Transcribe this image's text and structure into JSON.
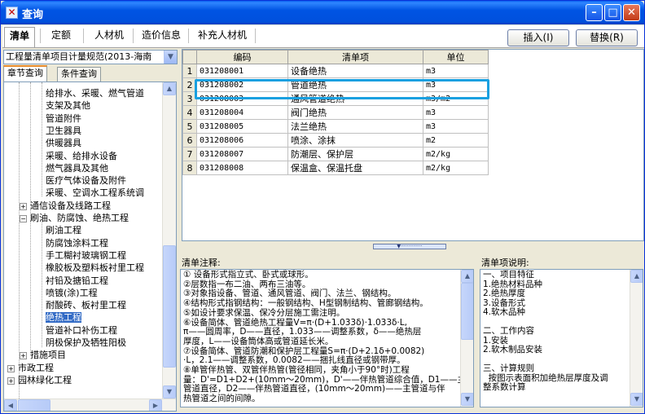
{
  "window": {
    "title": "查询",
    "icon": "app-icon",
    "buttons": [
      "minimize-icon",
      "maximize-icon",
      "close-icon"
    ]
  },
  "main_tabs": [
    "清单",
    "定额",
    "人材机",
    "造价信息",
    "补充人材机"
  ],
  "actions": {
    "insert": "插入(I)",
    "replace": "替换(R)"
  },
  "spec_select": "工程量清单项目计量规范(2013-海南",
  "left_tabs": [
    "章节查询",
    "条件查询"
  ],
  "tree": [
    {
      "label": "给排水、采暖、燃气管道",
      "level": 3
    },
    {
      "label": "支架及其他",
      "level": 3
    },
    {
      "label": "管道附件",
      "level": 3
    },
    {
      "label": "卫生器具",
      "level": 3
    },
    {
      "label": "供暖器具",
      "level": 3
    },
    {
      "label": "采暖、给排水设备",
      "level": 3
    },
    {
      "label": "燃气器具及其他",
      "level": 3
    },
    {
      "label": "医疗气体设备及附件",
      "level": 3
    },
    {
      "label": "采暖、空调水工程系统调",
      "level": 3
    },
    {
      "label": "通信设备及线路工程",
      "level": 2,
      "expander": "+"
    },
    {
      "label": "刷油、防腐蚀、绝热工程",
      "level": 2,
      "expander": "−"
    },
    {
      "label": "刷油工程",
      "level": 3
    },
    {
      "label": "防腐蚀涂料工程",
      "level": 3
    },
    {
      "label": "手工糊衬玻璃钢工程",
      "level": 3
    },
    {
      "label": "橡胶板及塑料板衬里工程",
      "level": 3
    },
    {
      "label": "衬铅及搪铅工程",
      "level": 3
    },
    {
      "label": "喷镀(涂)工程",
      "level": 3
    },
    {
      "label": "耐酸砖、板衬里工程",
      "level": 3
    },
    {
      "label": "绝热工程",
      "level": 3,
      "selected": true
    },
    {
      "label": "管道补口补伤工程",
      "level": 3
    },
    {
      "label": "阴极保护及牺牲阳极",
      "level": 3
    },
    {
      "label": "措施项目",
      "level": 2,
      "expander": "+"
    },
    {
      "label": "市政工程",
      "level": 1,
      "expander": "+"
    },
    {
      "label": "园林绿化工程",
      "level": 1,
      "expander": "+"
    }
  ],
  "table": {
    "headers": [
      "编码",
      "清单项",
      "单位"
    ],
    "rows": [
      {
        "n": "1",
        "code": "031208001",
        "name": "设备绝热",
        "unit": "m3"
      },
      {
        "n": "2",
        "code": "031208002",
        "name": "管道绝热",
        "unit": "m3"
      },
      {
        "n": "3",
        "code": "031208003",
        "name": "通风管道绝热",
        "unit": "m3/m2"
      },
      {
        "n": "4",
        "code": "031208004",
        "name": "阀门绝热",
        "unit": "m3"
      },
      {
        "n": "5",
        "code": "031208005",
        "name": "法兰绝热",
        "unit": "m3"
      },
      {
        "n": "6",
        "code": "031208006",
        "name": "喷涂、涂抹",
        "unit": "m2"
      },
      {
        "n": "7",
        "code": "031208007",
        "name": "防潮层、保护层",
        "unit": "m2/kg"
      },
      {
        "n": "8",
        "code": "031208008",
        "name": "保温盒、保温托盘",
        "unit": "m2/kg"
      }
    ]
  },
  "notes_label": "清单注释:",
  "notes": [
    "① 设备形式指立式、卧式或球形。",
    "②层数指一布二油、两布三油等。",
    "③对象指设备、管道、通风管道、阀门、法兰、钢结构。",
    "④结构形式指钢结构：一般钢结构、H型钢制结构、管廊钢结构。",
    "⑤如设计要求保温、保冷分层施工需注明。",
    "⑥设备简体、管道绝热工程量V=π·(D+1.033δ)·1.033δ·L,",
    "π——圆周率，D——直径，1.033——调整系数，δ——绝热层",
    "厚度，L——设备筒体高或管道延长米。",
    "⑦设备简体、管道防潮和保护层工程量S=π·(D+2.1δ+0.0082)",
    "·L，2.1——调整系数，0.0082——捆扎线直径或钢带厚。",
    "⑧单管伴热管、双管伴热管(管径相同，夹角小于90°时)工程",
    "量：D'=D1+D2+(10mm～20mm)，D'——伴热管道综合值，D1——主",
    "管道直径，D2——伴热管道直径，(10mm～20mm)——主管道与伴",
    "热管道之间的间隙。"
  ],
  "desc_label": "清单项说明:",
  "desc": [
    "一、项目特征",
    "1.绝热材料品种",
    "2.绝热厚度",
    "3.设备形式",
    "4.软木品种",
    "",
    "二、工作内容",
    "1.安装",
    "2.软木制品安装",
    "",
    "三、计算规则",
    "  按图示表面积加绝热层厚度及调",
    "整系数计算"
  ],
  "colors": {
    "selected": "#316ac5",
    "highlight": "#1aa0e0",
    "titlebar": "#0054e3"
  }
}
